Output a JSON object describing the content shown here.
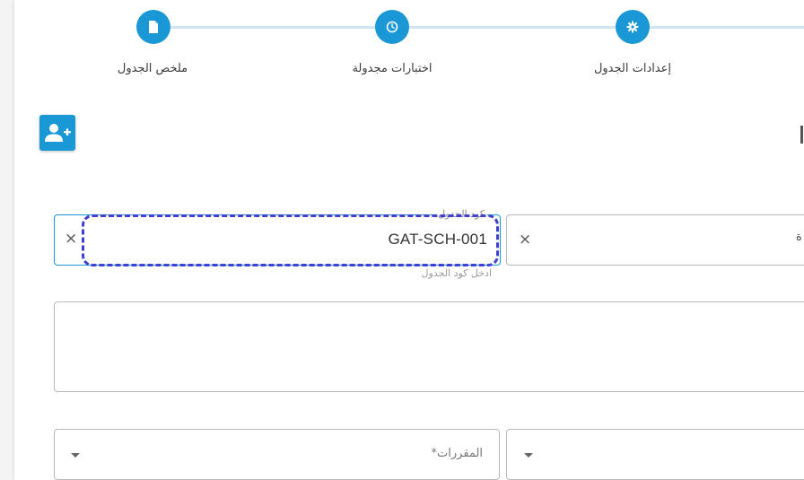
{
  "stepper": {
    "steps": [
      {
        "label": "ملخص الجدول",
        "icon": "document-icon"
      },
      {
        "label": "اختبارات مجدولة",
        "icon": "clock-icon"
      },
      {
        "label": "إعدادات الجدول",
        "icon": "gear-icon"
      }
    ]
  },
  "toolbar": {
    "add_user_icon": "add-user-icon"
  },
  "form": {
    "schedule_code": {
      "label": "كود الجدول",
      "value": "GAT-SCH-001",
      "hint": "ادخل كود الجدول",
      "clear_symbol": "×"
    },
    "right_field": {
      "clear_symbol": "×",
      "partial_text": "ة"
    },
    "description": {
      "value": ""
    },
    "courses_select": {
      "label": "المقررات*"
    },
    "right_select": {
      "label": ""
    }
  },
  "colors": {
    "primary": "#1a97d5",
    "highlight": "#3f3fd2"
  }
}
